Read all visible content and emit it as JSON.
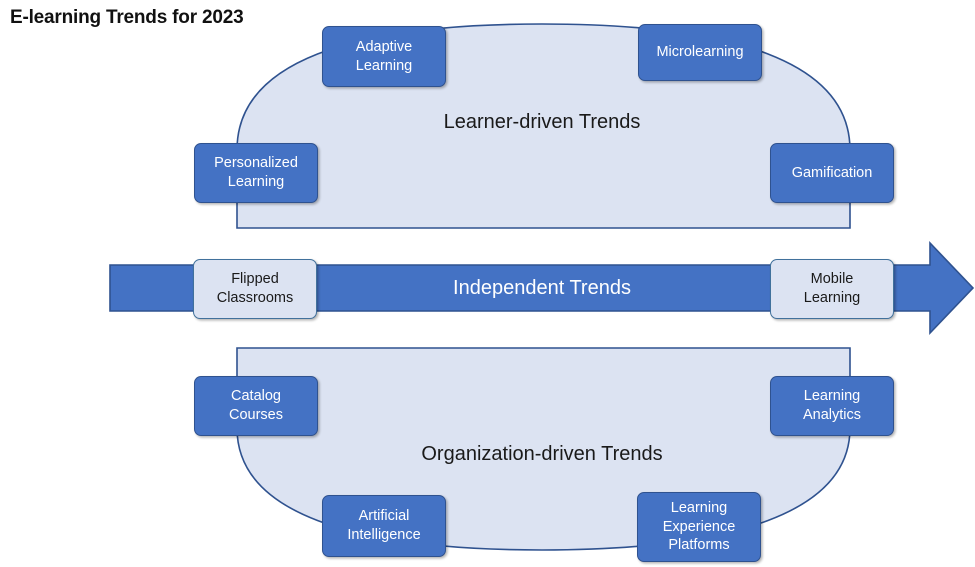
{
  "title": "E-learning Trends for 2023",
  "colors": {
    "node_fill": "#4472c4",
    "node_stroke": "#2f528f",
    "arch_fill": "#dce3f2",
    "arch_stroke": "#2f528f",
    "arrow_fill": "#4472c4",
    "arrow_stroke": "#2f528f",
    "text_dark": "#1a1a1a",
    "text_light": "#ffffff",
    "background": "#ffffff"
  },
  "sections": [
    {
      "id": "learner-driven",
      "label": "Learner-driven Trends",
      "shape": "arch-up",
      "label_style": "dark",
      "nodes": [
        {
          "id": "adaptive-learning",
          "label": "Adaptive Learning",
          "lines": [
            "Adaptive",
            "Learning"
          ],
          "style": "filled"
        },
        {
          "id": "microlearning",
          "label": "Microlearning",
          "lines": [
            "Microlearning"
          ],
          "style": "filled"
        },
        {
          "id": "personalized-learning",
          "label": "Personalized Learning",
          "lines": [
            "Personalized",
            "Learning"
          ],
          "style": "filled"
        },
        {
          "id": "gamification",
          "label": "Gamification",
          "lines": [
            "Gamification"
          ],
          "style": "filled"
        }
      ]
    },
    {
      "id": "independent",
      "label": "Independent Trends",
      "shape": "arrow-right",
      "label_style": "light",
      "nodes": [
        {
          "id": "flipped-classrooms",
          "label": "Flipped Classrooms",
          "lines": [
            "Flipped",
            "Classrooms"
          ],
          "style": "hollow"
        },
        {
          "id": "mobile-learning",
          "label": "Mobile Learning",
          "lines": [
            "Mobile",
            "Learning"
          ],
          "style": "hollow"
        }
      ]
    },
    {
      "id": "organization-driven",
      "label": "Organization-driven Trends",
      "shape": "arch-down",
      "label_style": "dark",
      "nodes": [
        {
          "id": "catalog-courses",
          "label": "Catalog Courses",
          "lines": [
            "Catalog",
            "Courses"
          ],
          "style": "filled"
        },
        {
          "id": "learning-analytics",
          "label": "Learning Analytics",
          "lines": [
            "Learning",
            "Analytics"
          ],
          "style": "filled"
        },
        {
          "id": "artificial-intelligence",
          "label": "Artificial Intelligence",
          "lines": [
            "Artificial",
            "Intelligence"
          ],
          "style": "filled"
        },
        {
          "id": "learning-experience-platforms",
          "label": "Learning Experience Platforms",
          "lines": [
            "Learning",
            "Experience",
            "Platforms"
          ],
          "style": "filled"
        }
      ]
    }
  ],
  "labels": {
    "learner_driven": "Learner-driven Trends",
    "independent": "Independent Trends",
    "organization_driven": "Organization-driven Trends"
  },
  "nodes": {
    "adaptive_learning_l1": "Adaptive",
    "adaptive_learning_l2": "Learning",
    "microlearning_l1": "Microlearning",
    "personalized_learning_l1": "Personalized",
    "personalized_learning_l2": "Learning",
    "gamification_l1": "Gamification",
    "flipped_classrooms_l1": "Flipped",
    "flipped_classrooms_l2": "Classrooms",
    "mobile_learning_l1": "Mobile",
    "mobile_learning_l2": "Learning",
    "catalog_courses_l1": "Catalog",
    "catalog_courses_l2": "Courses",
    "learning_analytics_l1": "Learning",
    "learning_analytics_l2": "Analytics",
    "artificial_intelligence_l1": "Artificial",
    "artificial_intelligence_l2": "Intelligence",
    "lxp_l1": "Learning",
    "lxp_l2": "Experience",
    "lxp_l3": "Platforms"
  }
}
